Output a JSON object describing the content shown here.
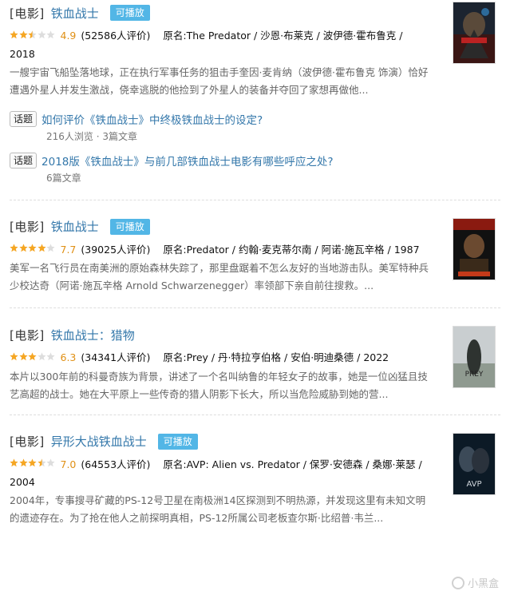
{
  "results": [
    {
      "tag": "[电影]",
      "title": "铁血战士",
      "playable": "可播放",
      "stars": 2.5,
      "rating": "4.9",
      "count": "(52586人评价)",
      "credits_line1": "原名:The Predator / 沙恩·布莱克 / 波伊德·霍布鲁克 /",
      "credits_line2": "2018",
      "summary": "一艘宇宙飞船坠落地球，正在执行军事任务的狙击手奎因·麦肯纳（波伊德·霍布鲁克 饰演）恰好遭遇外星人并发生激战，侥幸逃脱的他捡到了外星人的装备并夺回了家想再做他...",
      "topics": [
        {
          "tag": "话题",
          "title": "如何评价《铁血战士》中终极铁血战士的设定?",
          "sub": "216人浏览 · 3篇文章"
        },
        {
          "tag": "话题",
          "title": "2018版《铁血战士》与前几部铁血战士电影有哪些呼应之处?",
          "sub": "6篇文章"
        }
      ]
    },
    {
      "tag": "[电影]",
      "title": "铁血战士",
      "playable": "可播放",
      "stars": 4,
      "rating": "7.7",
      "count": "(39025人评价)",
      "credits_line1": "原名:Predator / 约翰·麦克蒂尔南 / 阿诺·施瓦辛格 / 1987",
      "credits_line2": "",
      "summary": "美军一名飞行员在南美洲的原始森林失踪了，那里盘踞着不怎么友好的当地游击队。美军特种兵少校达奇（阿诺·施瓦辛格 Arnold Schwarzenegger）率领部下亲自前往搜救。...",
      "topics": []
    },
    {
      "tag": "[电影]",
      "title": "铁血战士：猎物",
      "playable": "",
      "stars": 3,
      "rating": "6.3",
      "count": "(34341人评价)",
      "credits_line1": "原名:Prey / 丹·特拉亨伯格 / 安伯·明迪桑德 / 2022",
      "credits_line2": "",
      "summary": "本片以300年前的科曼奇族为背景，讲述了一个名叫纳鲁的年轻女子的故事，她是一位凶猛且技艺高超的战士。她在大平原上一些传奇的猎人阴影下长大，所以当危险威胁到她的营...",
      "topics": []
    },
    {
      "tag": "[电影]",
      "title": "异形大战铁血战士",
      "playable": "可播放",
      "stars": 3.5,
      "rating": "7.0",
      "count": "(64553人评价)",
      "credits_line1": "原名:AVP: Alien vs. Predator / 保罗·安德森 / 桑娜·莱瑟 /",
      "credits_line2": "2004",
      "summary": "2004年，专事搜寻矿藏的PS-12号卫星在南极洲14区探测到不明热源，并发现这里有未知文明的遗迹存在。为了抢在他人之前探明真相，PS-12所属公司老板查尔斯·比绍普·韦兰...",
      "topics": []
    }
  ],
  "watermark": "小黑盒",
  "colors": {
    "link": "#3377aa",
    "star": "#f5a623",
    "rating": "#e09015",
    "badge": "#52b6e6"
  }
}
